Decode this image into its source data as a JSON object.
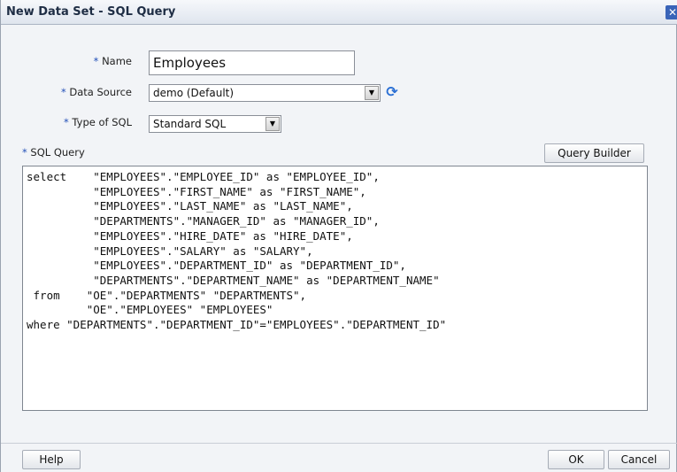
{
  "dialog": {
    "title": "New Data Set - SQL Query",
    "close_icon": "close-icon"
  },
  "form": {
    "name_label": "Name",
    "name_value": "Employees",
    "data_source_label": "Data Source",
    "data_source_value": "demo (Default)",
    "refresh_icon": "refresh-icon",
    "sql_type_label": "Type of SQL",
    "sql_type_value": "Standard SQL",
    "required_marker": "*",
    "sql_query_label": "SQL Query",
    "query_builder_label": "Query Builder",
    "sql_text": "select    \"EMPLOYEES\".\"EMPLOYEE_ID\" as \"EMPLOYEE_ID\",\n          \"EMPLOYEES\".\"FIRST_NAME\" as \"FIRST_NAME\",\n          \"EMPLOYEES\".\"LAST_NAME\" as \"LAST_NAME\",\n          \"DEPARTMENTS\".\"MANAGER_ID\" as \"MANAGER_ID\",\n          \"EMPLOYEES\".\"HIRE_DATE\" as \"HIRE_DATE\",\n          \"EMPLOYEES\".\"SALARY\" as \"SALARY\",\n          \"EMPLOYEES\".\"DEPARTMENT_ID\" as \"DEPARTMENT_ID\",\n          \"DEPARTMENTS\".\"DEPARTMENT_NAME\" as \"DEPARTMENT_NAME\"\n from    \"OE\".\"DEPARTMENTS\" \"DEPARTMENTS\",\n         \"OE\".\"EMPLOYEES\" \"EMPLOYEES\"\nwhere \"DEPARTMENTS\".\"DEPARTMENT_ID\"=\"EMPLOYEES\".\"DEPARTMENT_ID\""
  },
  "footer": {
    "help_label": "Help",
    "ok_label": "OK",
    "cancel_label": "Cancel"
  },
  "colors": {
    "required_marker": "#2350b8",
    "title_text": "#1e2d44",
    "close_button": "#3a64b8"
  }
}
